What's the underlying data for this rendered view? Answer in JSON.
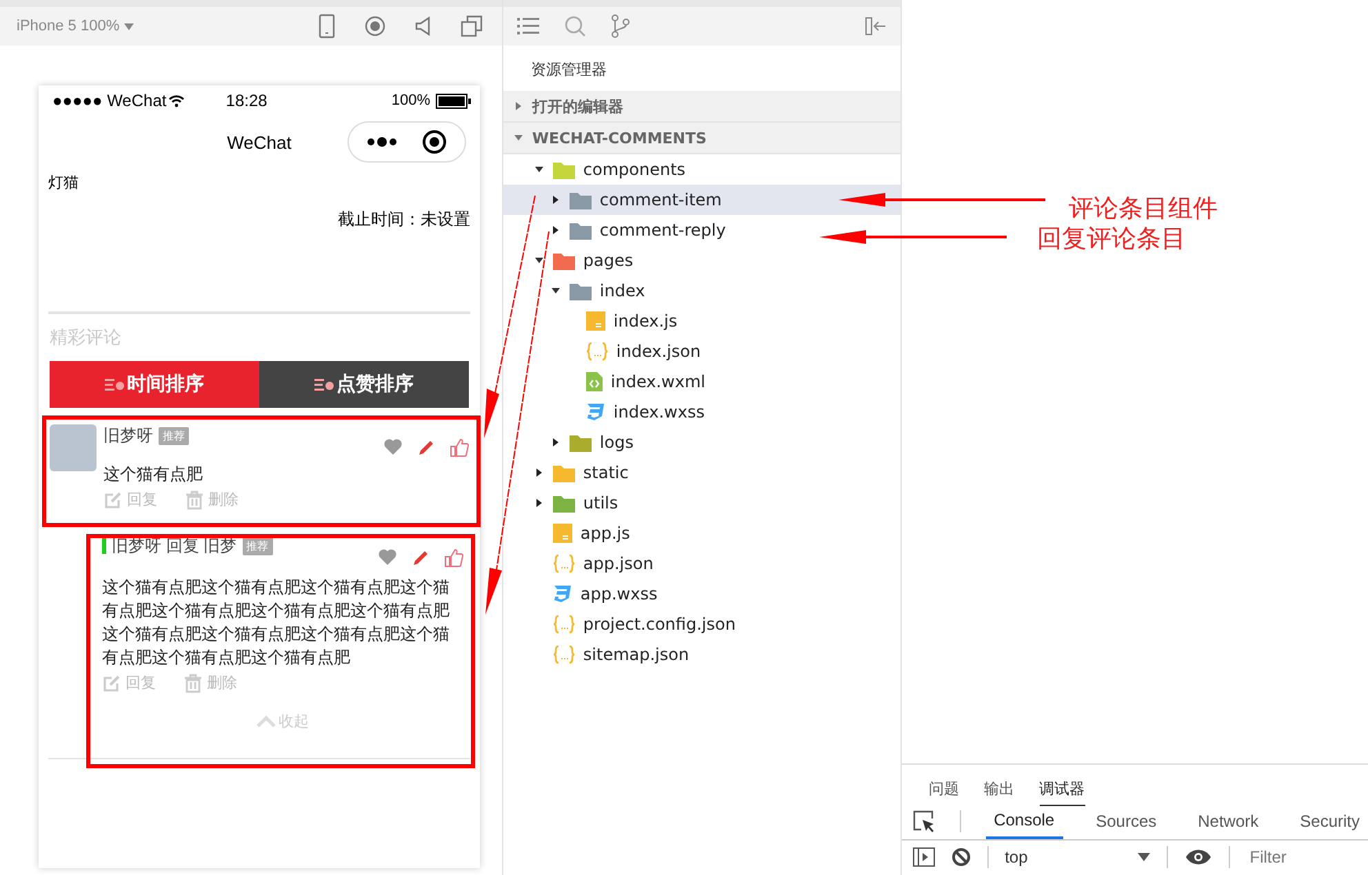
{
  "simulator": {
    "device": "iPhone 5 100%"
  },
  "phone": {
    "status_bar": {
      "carrier": "●●●●● WeChat",
      "time": "18:28",
      "battery": "100%"
    },
    "nav_title": "WeChat",
    "page_title": "灯猫",
    "deadline": "截止时间：未设置",
    "section_title": "精彩评论",
    "sort_tabs": [
      {
        "label": "时间排序",
        "selected": true
      },
      {
        "label": "点赞排序",
        "selected": false
      }
    ],
    "comment": {
      "author": "旧梦呀",
      "badge": "推荐",
      "text": "这个猫有点肥",
      "actions": [
        "回复",
        "删除"
      ]
    },
    "reply": {
      "author_line": "旧梦呀 回复 旧梦",
      "badge": "推荐",
      "text": "这个猫有点肥这个猫有点肥这个猫有点肥这个猫有点肥这个猫有点肥这个猫有点肥这个猫有点肥这个猫有点肥这个猫有点肥这个猫有点肥这个猫有点肥这个猫有点肥这个猫有点肥",
      "actions": [
        "回复",
        "删除"
      ],
      "collapse": "收起"
    }
  },
  "explorer": {
    "title": "资源管理器",
    "sections": [
      {
        "label": "打开的编辑器",
        "expanded": false
      },
      {
        "label": "WECHAT-COMMENTS",
        "expanded": true
      }
    ],
    "tree": [
      {
        "label": "components",
        "kind": "folder",
        "color": "#c5d63c",
        "expanded": true,
        "selected": false,
        "children": [
          {
            "label": "comment-item",
            "kind": "folder",
            "color": "#8a99a6",
            "expanded": false,
            "selected": true
          },
          {
            "label": "comment-reply",
            "kind": "folder",
            "color": "#8a99a6",
            "expanded": false,
            "selected": false
          }
        ]
      },
      {
        "label": "pages",
        "kind": "folder",
        "color": "#f26b4f",
        "expanded": true,
        "selected": false,
        "children": [
          {
            "label": "index",
            "kind": "folder",
            "color": "#8a99a6",
            "expanded": true,
            "selected": false,
            "children": [
              {
                "label": "index.js",
                "kind": "js",
                "selected": false
              },
              {
                "label": "index.json",
                "kind": "json",
                "selected": false
              },
              {
                "label": "index.wxml",
                "kind": "wxml",
                "selected": false
              },
              {
                "label": "index.wxss",
                "kind": "wxss",
                "selected": false
              }
            ]
          },
          {
            "label": "logs",
            "kind": "folder",
            "color": "#a9ac2c",
            "expanded": false,
            "selected": false
          }
        ]
      },
      {
        "label": "static",
        "kind": "folder",
        "color": "#f5b82e",
        "expanded": false,
        "selected": false
      },
      {
        "label": "utils",
        "kind": "folder",
        "color": "#7cb342",
        "expanded": false,
        "selected": false
      },
      {
        "label": "app.js",
        "kind": "js",
        "selected": false
      },
      {
        "label": "app.json",
        "kind": "json",
        "selected": false
      },
      {
        "label": "app.wxss",
        "kind": "wxss",
        "selected": false
      },
      {
        "label": "project.config.json",
        "kind": "json",
        "selected": false
      },
      {
        "label": "sitemap.json",
        "kind": "json",
        "selected": false
      }
    ]
  },
  "devtools": {
    "tabs": [
      {
        "label": "问题",
        "selected": false
      },
      {
        "label": "输出",
        "selected": false
      },
      {
        "label": "调试器",
        "selected": true
      }
    ],
    "panels": [
      {
        "label": "Console",
        "selected": true
      },
      {
        "label": "Sources",
        "selected": false
      },
      {
        "label": "Network",
        "selected": false
      },
      {
        "label": "Security",
        "selected": false
      }
    ],
    "context": "top",
    "filter": {
      "placeholder": "Filter"
    }
  },
  "annotations": [
    "评论条目组件",
    "回复评论条目"
  ]
}
